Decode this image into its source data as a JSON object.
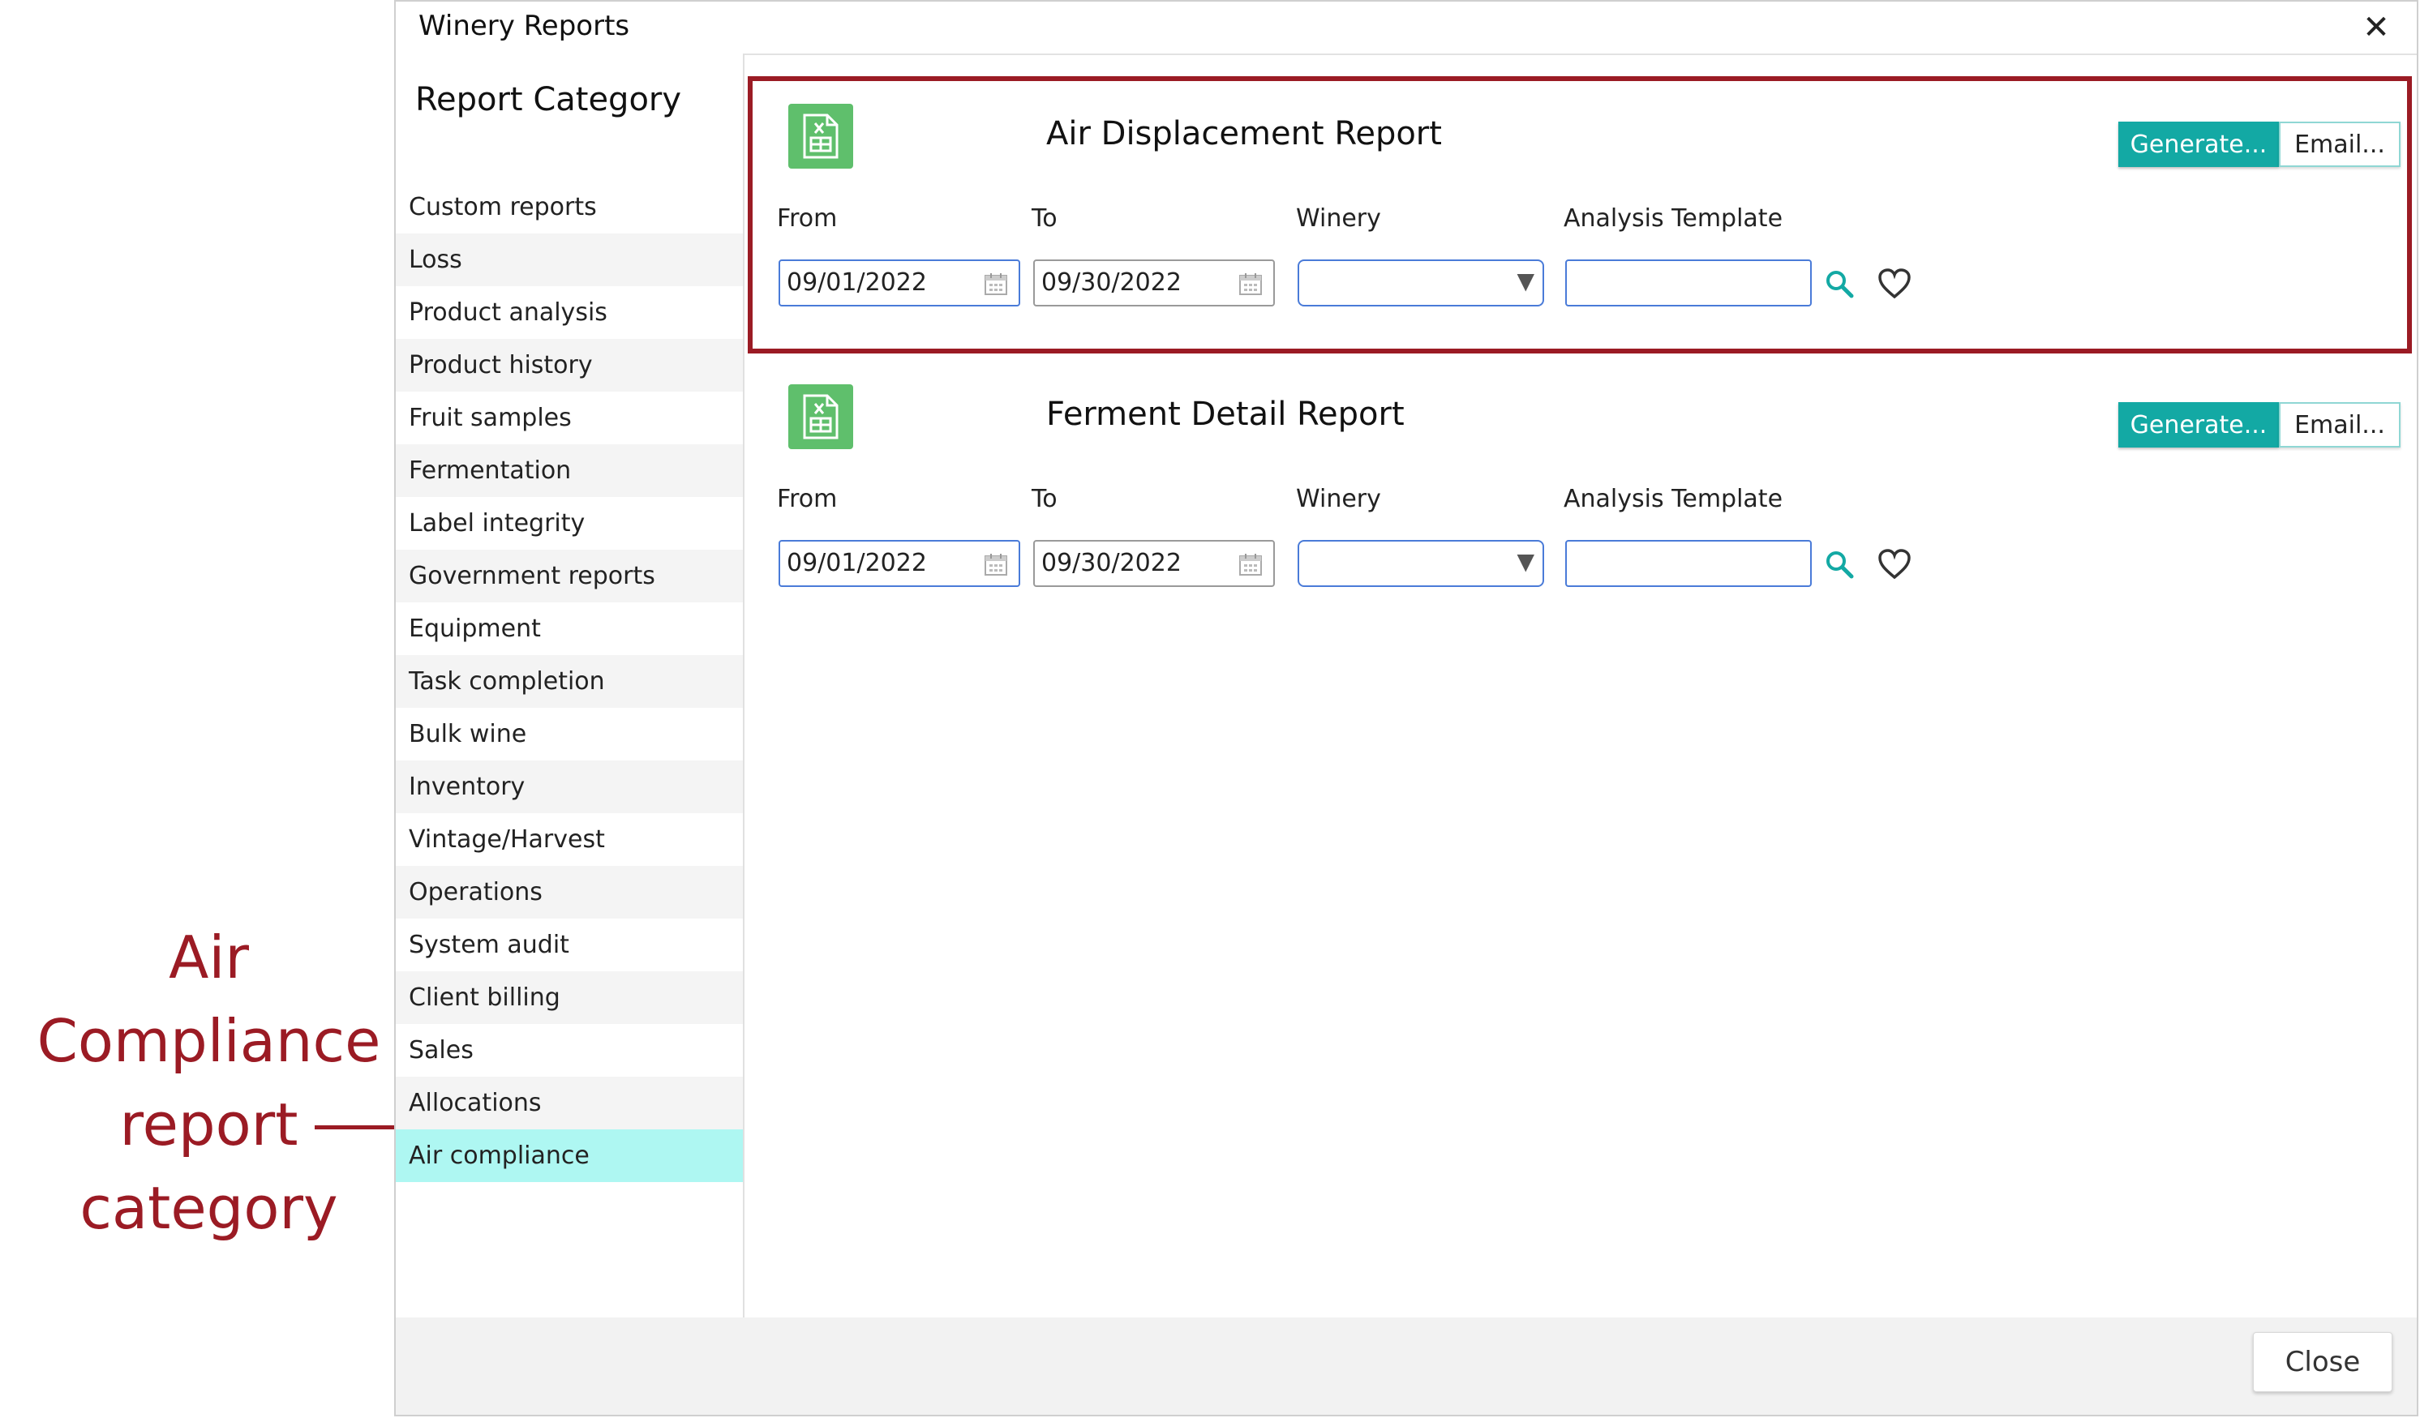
{
  "annotation": {
    "lines": [
      "Air",
      "Compliance",
      "report",
      "category"
    ]
  },
  "dialog": {
    "title": "Winery Reports",
    "close_glyph": "✕"
  },
  "sidebar": {
    "heading": "Report Category",
    "items": [
      {
        "label": "Custom reports"
      },
      {
        "label": "Loss"
      },
      {
        "label": "Product analysis"
      },
      {
        "label": "Product history"
      },
      {
        "label": "Fruit samples"
      },
      {
        "label": "Fermentation"
      },
      {
        "label": "Label integrity"
      },
      {
        "label": "Government reports"
      },
      {
        "label": "Equipment"
      },
      {
        "label": "Task completion"
      },
      {
        "label": "Bulk wine"
      },
      {
        "label": "Inventory"
      },
      {
        "label": "Vintage/Harvest"
      },
      {
        "label": "Operations"
      },
      {
        "label": "System audit"
      },
      {
        "label": "Client billing"
      },
      {
        "label": "Sales"
      },
      {
        "label": "Allocations"
      },
      {
        "label": "Air compliance"
      }
    ],
    "active_index": 18
  },
  "reports": [
    {
      "title": "Air Displacement Report",
      "generate_label": "Generate...",
      "email_label": "Email...",
      "from_label": "From",
      "to_label": "To",
      "winery_label": "Winery",
      "analysis_label": "Analysis Template",
      "from_value": "09/01/2022",
      "to_value": "09/30/2022",
      "winery_value": "",
      "analysis_value": ""
    },
    {
      "title": "Ferment Detail Report",
      "generate_label": "Generate...",
      "email_label": "Email...",
      "from_label": "From",
      "to_label": "To",
      "winery_label": "Winery",
      "analysis_label": "Analysis Template",
      "from_value": "09/01/2022",
      "to_value": "09/30/2022",
      "winery_value": "",
      "analysis_value": ""
    }
  ],
  "footer": {
    "close_label": "Close"
  },
  "colors": {
    "accent": "#13a9a4",
    "highlight": "#9b1b24",
    "active_category": "#aef7f2",
    "excel_icon": "#5fbf6c"
  },
  "icons": {
    "report": "excel-file-icon",
    "date": "calendar-icon",
    "dropdown": "triangle-down-icon",
    "search": "search-icon",
    "favorite": "heart-icon"
  }
}
